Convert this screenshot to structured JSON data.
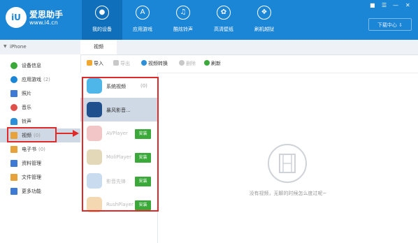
{
  "header": {
    "logo_glyph": "iU",
    "title": "爱思助手",
    "url": "www.i4.cn",
    "nav": [
      {
        "label": "我的设备",
        "icon": "apple-icon"
      },
      {
        "label": "应用游戏",
        "icon": "app-store-icon"
      },
      {
        "label": "酷炫铃声",
        "icon": "music-note-icon"
      },
      {
        "label": "高清壁纸",
        "icon": "flower-icon"
      },
      {
        "label": "刷机越狱",
        "icon": "dropbox-icon"
      }
    ],
    "download_center": "下载中心",
    "accent": "#1b85d6"
  },
  "device": {
    "name": "iPhone"
  },
  "tab": {
    "label": "视频"
  },
  "sidebar": {
    "items": [
      {
        "label": "设备信息",
        "count": "",
        "icon": "info-icon",
        "color": "#3aa93a"
      },
      {
        "label": "应用游戏",
        "count": "(2)",
        "icon": "app-icon",
        "color": "#1b85d6"
      },
      {
        "label": "照片",
        "count": "",
        "icon": "photo-icon",
        "color": "#3d7bd4"
      },
      {
        "label": "音乐",
        "count": "",
        "icon": "music-icon",
        "color": "#e0504a"
      },
      {
        "label": "铃声",
        "count": "",
        "icon": "bell-icon",
        "color": "#2b8fd9"
      },
      {
        "label": "视频",
        "count": "(0)",
        "icon": "video-icon",
        "color": "#e8a23c"
      },
      {
        "label": "电子书",
        "count": "(0)",
        "icon": "book-icon",
        "color": "#e8a23c"
      },
      {
        "label": "资料管理",
        "count": "",
        "icon": "contacts-icon",
        "color": "#3d7bd4"
      },
      {
        "label": "文件管理",
        "count": "",
        "icon": "file-icon",
        "color": "#e8a23c"
      },
      {
        "label": "更多功能",
        "count": "",
        "icon": "more-icon",
        "color": "#3d7bd4"
      }
    ]
  },
  "toolbar": {
    "import": "导入",
    "export": "导出",
    "convert": "视频转换",
    "delete": "删除",
    "refresh": "刷新"
  },
  "apps": [
    {
      "name": "系统视频",
      "count": "(0)"
    },
    {
      "name": "暴风影音...",
      "count": ""
    },
    {
      "name": "AVPlayer",
      "install": "安装"
    },
    {
      "name": "MoliPlayer",
      "install": "安装"
    },
    {
      "name": "影音先锋",
      "install": "安装"
    },
    {
      "name": "RushPlayer",
      "install": "安装"
    }
  ],
  "empty": {
    "message": "没有视频，无聊的时候怎么度过呢~"
  }
}
